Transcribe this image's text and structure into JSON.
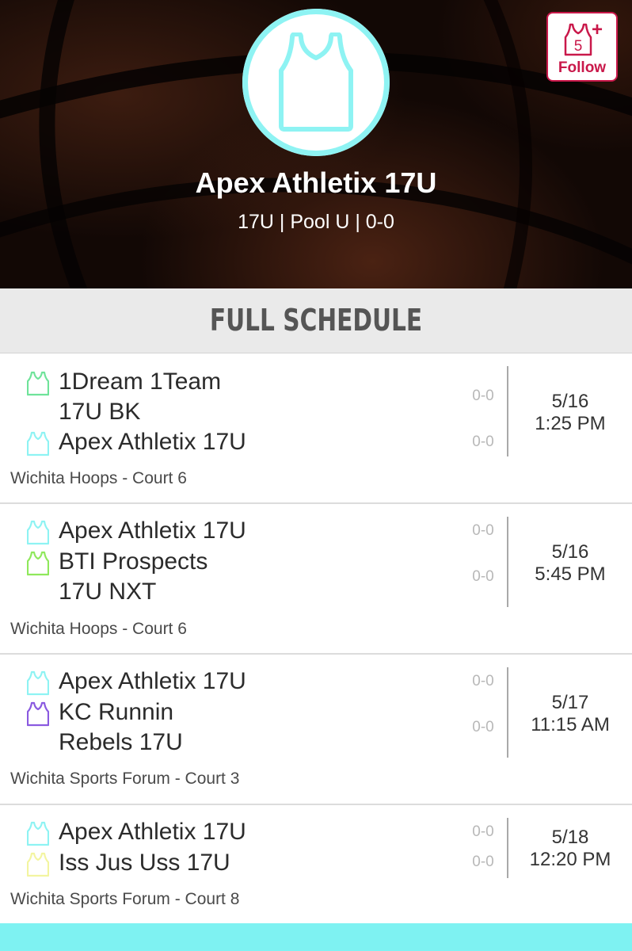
{
  "header": {
    "team_name": "Apex Athletix 17U",
    "subtitle": "17U | Pool U | 0-0",
    "follow": {
      "label": "Follow",
      "count_badge": "5",
      "plus": "+"
    },
    "logo_icon": "jersey-icon",
    "colors": {
      "logo_ring": "#8ef3f3",
      "follow": "#c9184a"
    }
  },
  "section": {
    "title": "FULL SCHEDULE"
  },
  "games": [
    {
      "team1": {
        "lines": [
          "1Dream 1Team",
          "17U BK"
        ],
        "score": "0-0",
        "jersey_color": "#6fe39a"
      },
      "team2": {
        "lines": [
          "Apex Athletix 17U"
        ],
        "score": "0-0",
        "jersey_color": "#8ef3f3"
      },
      "date": "5/16",
      "time": "1:25 PM",
      "venue": "Wichita Hoops - Court 6"
    },
    {
      "team1": {
        "lines": [
          "Apex Athletix 17U"
        ],
        "score": "0-0",
        "jersey_color": "#8ef3f3"
      },
      "team2": {
        "lines": [
          "BTI Prospects",
          "17U NXT"
        ],
        "score": "0-0",
        "jersey_color": "#8fe85c"
      },
      "date": "5/16",
      "time": "5:45 PM",
      "venue": "Wichita Hoops - Court 6"
    },
    {
      "team1": {
        "lines": [
          "Apex Athletix 17U"
        ],
        "score": "0-0",
        "jersey_color": "#8ef3f3"
      },
      "team2": {
        "lines": [
          "KC Runnin",
          "Rebels 17U"
        ],
        "score": "0-0",
        "jersey_color": "#8a5ae0"
      },
      "date": "5/17",
      "time": "11:15 AM",
      "venue": "Wichita Sports Forum - Court 3"
    },
    {
      "team1": {
        "lines": [
          "Apex Athletix 17U"
        ],
        "score": "0-0",
        "jersey_color": "#8ef3f3"
      },
      "team2": {
        "lines": [
          "Iss Jus Uss 17U"
        ],
        "score": "0-0",
        "jersey_color": "#f3f5a0"
      },
      "date": "5/18",
      "time": "12:20 PM",
      "venue": "Wichita Sports Forum - Court 8"
    }
  ],
  "bottom_bar_color": "#7ef2f2"
}
